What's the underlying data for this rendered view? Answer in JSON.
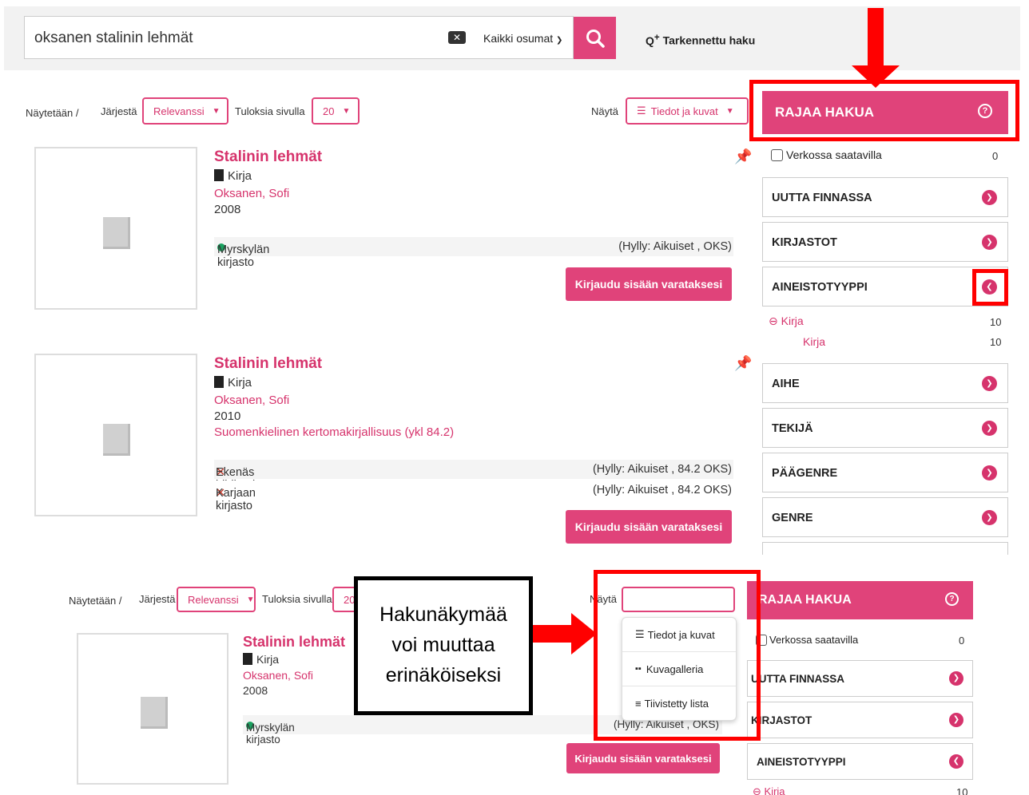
{
  "search": {
    "query": "oksanen stalinin lehmät",
    "scope": "Kaikki osumat",
    "advanced_label": "Tarkennettu haku"
  },
  "toolbar": {
    "showing": "Näytetään /",
    "sort_label": "Järjestä",
    "sort_value": "Relevanssi",
    "per_page_label": "Tuloksia sivulla",
    "per_page_value": "20",
    "per_page_value_clipped": "20",
    "view_label": "Näytä",
    "view_value": "Tiedot ja kuvat"
  },
  "results": [
    {
      "title": "Stalinin lehmät",
      "format": "Kirja",
      "author": "Oksanen, Sofi",
      "year": "2008",
      "holdings": [
        {
          "library": "Myrskylän kirjasto",
          "status": "available",
          "shelf": "(Hylly: Aikuiset , OKS)"
        }
      ],
      "login_button": "Kirjaudu sisään varataksesi"
    },
    {
      "title": "Stalinin lehmät",
      "format": "Kirja",
      "author": "Oksanen, Sofi",
      "year": "2010",
      "subject": "Suomenkielinen kertomakirjallisuus (ykl 84.2)",
      "holdings": [
        {
          "library": "Ekenäs bibliotek",
          "status": "unavailable",
          "shelf": "(Hylly: Aikuiset , 84.2 OKS)"
        },
        {
          "library": "Karjaan kirjasto",
          "status": "unavailable",
          "shelf": "(Hylly: Aikuiset , 84.2 OKS)"
        }
      ],
      "login_button": "Kirjaudu sisään varataksesi"
    }
  ],
  "facets": {
    "header": "RAJAA HAKUA",
    "online_label": "Verkossa saatavilla",
    "online_count": "0",
    "groups": [
      "UUTTA FINNASSA",
      "KIRJASTOT",
      "AINEISTOTYYPPI",
      "AIHE",
      "TEKIJÄ",
      "PÄÄGENRE",
      "GENRE"
    ],
    "type_selected": {
      "label": "Kirja",
      "count": "10"
    },
    "type_sub": {
      "label": "Kirja",
      "count": "10"
    }
  },
  "zoom": {
    "result": {
      "title": "Stalinin lehmät",
      "format": "Kirja",
      "author": "Oksanen, Sofi",
      "year": "2008",
      "library": "Myrskylän kirjasto",
      "shelf_partial": "(Hylly: Aikuiset , OKS)"
    },
    "login_button": "Kirjaudu sisään varataksesi",
    "menu": [
      "Tiedot ja kuvat",
      "Kuvagalleria",
      "Tiivistetty lista"
    ],
    "facets_header": "RAJAA HAKUA",
    "online_label": "Verkossa saatavilla",
    "online_count": "0",
    "groups_partial": [
      "UUTTA FINNASSA",
      "KIRJASTOT",
      "AINEISTOTYYPPI"
    ],
    "type_partial": {
      "label": "Kirja",
      "count": "10"
    }
  },
  "callout": {
    "line1": "Hakunäkymää",
    "line2": "voi muuttaa",
    "line3": "erinäköiseksi"
  },
  "colors": {
    "accent": "#e0437a",
    "annotation": "#ff0000",
    "available": "#1aa260",
    "unavailable": "#c0392b"
  }
}
